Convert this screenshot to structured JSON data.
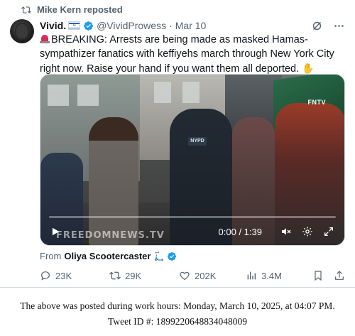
{
  "repost": {
    "text": "Mike Kern reposted"
  },
  "author": {
    "name": "Vivid.",
    "handle": "@VividProwess",
    "date": "Mar 10"
  },
  "tweet": {
    "text_lead": "BREAKING: Arrests are being made as masked Hamas-sympathizer fanatics with keffiyehs march through New York City right now. Raise your hand if you want them all deported.",
    "hand_emoji": "✋"
  },
  "video": {
    "watermark": "FREEDOMNEWS.TV",
    "corner_tag": "FNTV",
    "badge": "NYPD",
    "time": "0:00 / 1:39",
    "progress": 0
  },
  "source": {
    "prefix": "From",
    "name": "Oliya Scootercaster",
    "emoji": "🛴"
  },
  "actions": {
    "replies": "23K",
    "reposts": "29K",
    "likes": "202K",
    "views": "3.4M"
  },
  "caption": {
    "line1": "The above was posted during work hours: Monday, March 10, 2025, at 04:07 PM.",
    "line2": "Tweet ID #: 1899220648834048009"
  },
  "colors": {
    "accent": "#1d9bf0",
    "muted": "#536471",
    "text": "#0f1419"
  }
}
